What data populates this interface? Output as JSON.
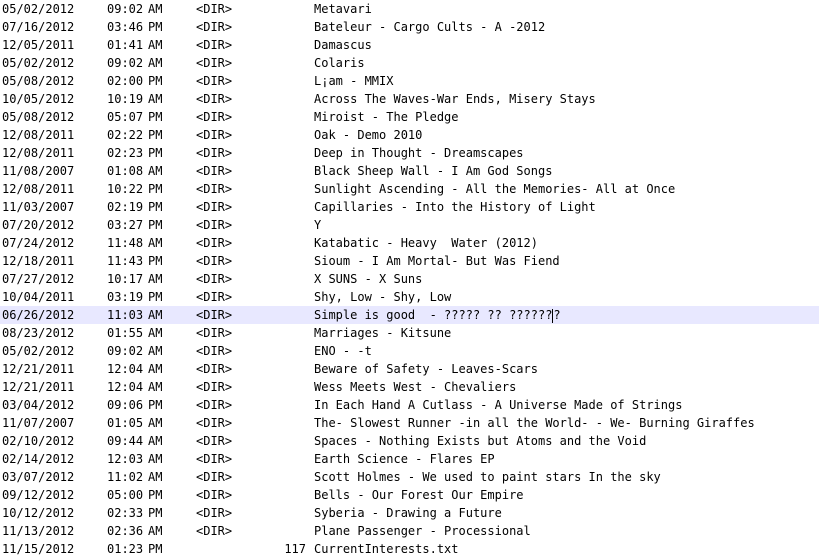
{
  "listing": {
    "rows": [
      {
        "date": "05/02/2012",
        "time": "09:02",
        "ampm": "AM",
        "type": "<DIR>",
        "size": "",
        "name": "Metavari"
      },
      {
        "date": "07/16/2012",
        "time": "03:46",
        "ampm": "PM",
        "type": "<DIR>",
        "size": "",
        "name": "Bateleur - Cargo Cults - A -2012"
      },
      {
        "date": "12/05/2011",
        "time": "01:41",
        "ampm": "AM",
        "type": "<DIR>",
        "size": "",
        "name": "Damascus"
      },
      {
        "date": "05/02/2012",
        "time": "09:02",
        "ampm": "AM",
        "type": "<DIR>",
        "size": "",
        "name": "Colaris"
      },
      {
        "date": "05/08/2012",
        "time": "02:00",
        "ampm": "PM",
        "type": "<DIR>",
        "size": "",
        "name": "L¡am - MMIX"
      },
      {
        "date": "10/05/2012",
        "time": "10:19",
        "ampm": "AM",
        "type": "<DIR>",
        "size": "",
        "name": "Across The Waves-War Ends, Misery Stays"
      },
      {
        "date": "05/08/2012",
        "time": "05:07",
        "ampm": "PM",
        "type": "<DIR>",
        "size": "",
        "name": "Miroist - The Pledge"
      },
      {
        "date": "12/08/2011",
        "time": "02:22",
        "ampm": "PM",
        "type": "<DIR>",
        "size": "",
        "name": "Oak - Demo 2010"
      },
      {
        "date": "12/08/2011",
        "time": "02:23",
        "ampm": "PM",
        "type": "<DIR>",
        "size": "",
        "name": "Deep in Thought - Dreamscapes"
      },
      {
        "date": "11/08/2007",
        "time": "01:08",
        "ampm": "AM",
        "type": "<DIR>",
        "size": "",
        "name": "Black Sheep Wall - I Am God Songs"
      },
      {
        "date": "12/08/2011",
        "time": "10:22",
        "ampm": "PM",
        "type": "<DIR>",
        "size": "",
        "name": "Sunlight Ascending - All the Memories- All at Once"
      },
      {
        "date": "11/03/2007",
        "time": "02:19",
        "ampm": "PM",
        "type": "<DIR>",
        "size": "",
        "name": "Capillaries - Into the History of Light"
      },
      {
        "date": "07/20/2012",
        "time": "03:27",
        "ampm": "PM",
        "type": "<DIR>",
        "size": "",
        "name": "Y"
      },
      {
        "date": "07/24/2012",
        "time": "11:48",
        "ampm": "AM",
        "type": "<DIR>",
        "size": "",
        "name": "Katabatic - Heavy  Water (2012)"
      },
      {
        "date": "12/18/2011",
        "time": "11:43",
        "ampm": "PM",
        "type": "<DIR>",
        "size": "",
        "name": "Sioum - I Am Mortal- But Was Fiend"
      },
      {
        "date": "07/27/2012",
        "time": "10:17",
        "ampm": "AM",
        "type": "<DIR>",
        "size": "",
        "name": "X SUNS - X Suns"
      },
      {
        "date": "10/04/2011",
        "time": "03:19",
        "ampm": "PM",
        "type": "<DIR>",
        "size": "",
        "name": "Shy, Low - Shy, Low"
      },
      {
        "date": "06/26/2012",
        "time": "11:03",
        "ampm": "AM",
        "type": "<DIR>",
        "size": "",
        "name": "Simple is good  - ????? ?? ??????",
        "highlight": true,
        "caret": "?"
      },
      {
        "date": "08/23/2012",
        "time": "01:55",
        "ampm": "AM",
        "type": "<DIR>",
        "size": "",
        "name": "Marriages - Kitsune"
      },
      {
        "date": "05/02/2012",
        "time": "09:02",
        "ampm": "AM",
        "type": "<DIR>",
        "size": "",
        "name": "ENO - -t"
      },
      {
        "date": "12/21/2011",
        "time": "12:04",
        "ampm": "AM",
        "type": "<DIR>",
        "size": "",
        "name": "Beware of Safety - Leaves-Scars"
      },
      {
        "date": "12/21/2011",
        "time": "12:04",
        "ampm": "AM",
        "type": "<DIR>",
        "size": "",
        "name": "Wess Meets West - Chevaliers"
      },
      {
        "date": "03/04/2012",
        "time": "09:06",
        "ampm": "PM",
        "type": "<DIR>",
        "size": "",
        "name": "In Each Hand A Cutlass - A Universe Made of Strings"
      },
      {
        "date": "11/07/2007",
        "time": "01:05",
        "ampm": "AM",
        "type": "<DIR>",
        "size": "",
        "name": "The- Slowest Runner -in all the World- - We- Burning Giraffes"
      },
      {
        "date": "02/10/2012",
        "time": "09:44",
        "ampm": "AM",
        "type": "<DIR>",
        "size": "",
        "name": "Spaces - Nothing Exists but Atoms and the Void"
      },
      {
        "date": "02/14/2012",
        "time": "12:03",
        "ampm": "AM",
        "type": "<DIR>",
        "size": "",
        "name": "Earth Science - Flares EP"
      },
      {
        "date": "03/07/2012",
        "time": "11:02",
        "ampm": "AM",
        "type": "<DIR>",
        "size": "",
        "name": "Scott Holmes - We used to paint stars In the sky"
      },
      {
        "date": "09/12/2012",
        "time": "05:00",
        "ampm": "PM",
        "type": "<DIR>",
        "size": "",
        "name": "Bells - Our Forest Our Empire"
      },
      {
        "date": "10/12/2012",
        "time": "02:33",
        "ampm": "PM",
        "type": "<DIR>",
        "size": "",
        "name": "Syberia - Drawing a Future"
      },
      {
        "date": "11/13/2012",
        "time": "02:36",
        "ampm": "AM",
        "type": "<DIR>",
        "size": "",
        "name": "Plane Passenger - Processional"
      },
      {
        "date": "11/15/2012",
        "time": "01:23",
        "ampm": "PM",
        "type": "",
        "size": "117",
        "name": "CurrentInterests.txt"
      }
    ]
  },
  "colors": {
    "background": "#ffffff",
    "text": "#000000",
    "highlight": "#e8e8ff"
  }
}
